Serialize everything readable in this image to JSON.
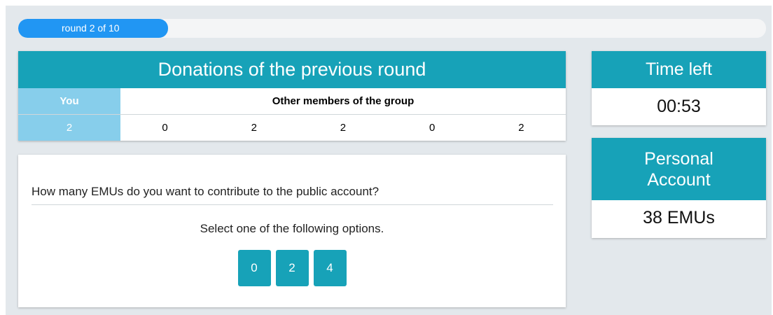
{
  "progress": {
    "label": "round 2 of 10",
    "fraction": 0.2
  },
  "donations": {
    "title": "Donations of the previous round",
    "you_header": "You",
    "others_header": "Other members of the group",
    "you_value": "2",
    "others_values": [
      "0",
      "2",
      "2",
      "0",
      "2"
    ]
  },
  "question": {
    "text": "How many EMUs do you want to contribute to the public account?",
    "instruction": "Select one of the following options.",
    "options": [
      "0",
      "2",
      "4"
    ]
  },
  "timer": {
    "title": "Time left",
    "value": "00:53"
  },
  "account": {
    "title": "Personal Account",
    "value": "38 EMUs"
  },
  "colors": {
    "accent": "#17a2b8",
    "progress": "#2196f3",
    "you_cell": "#87ceeb",
    "page_bg": "#e3e8ec"
  }
}
